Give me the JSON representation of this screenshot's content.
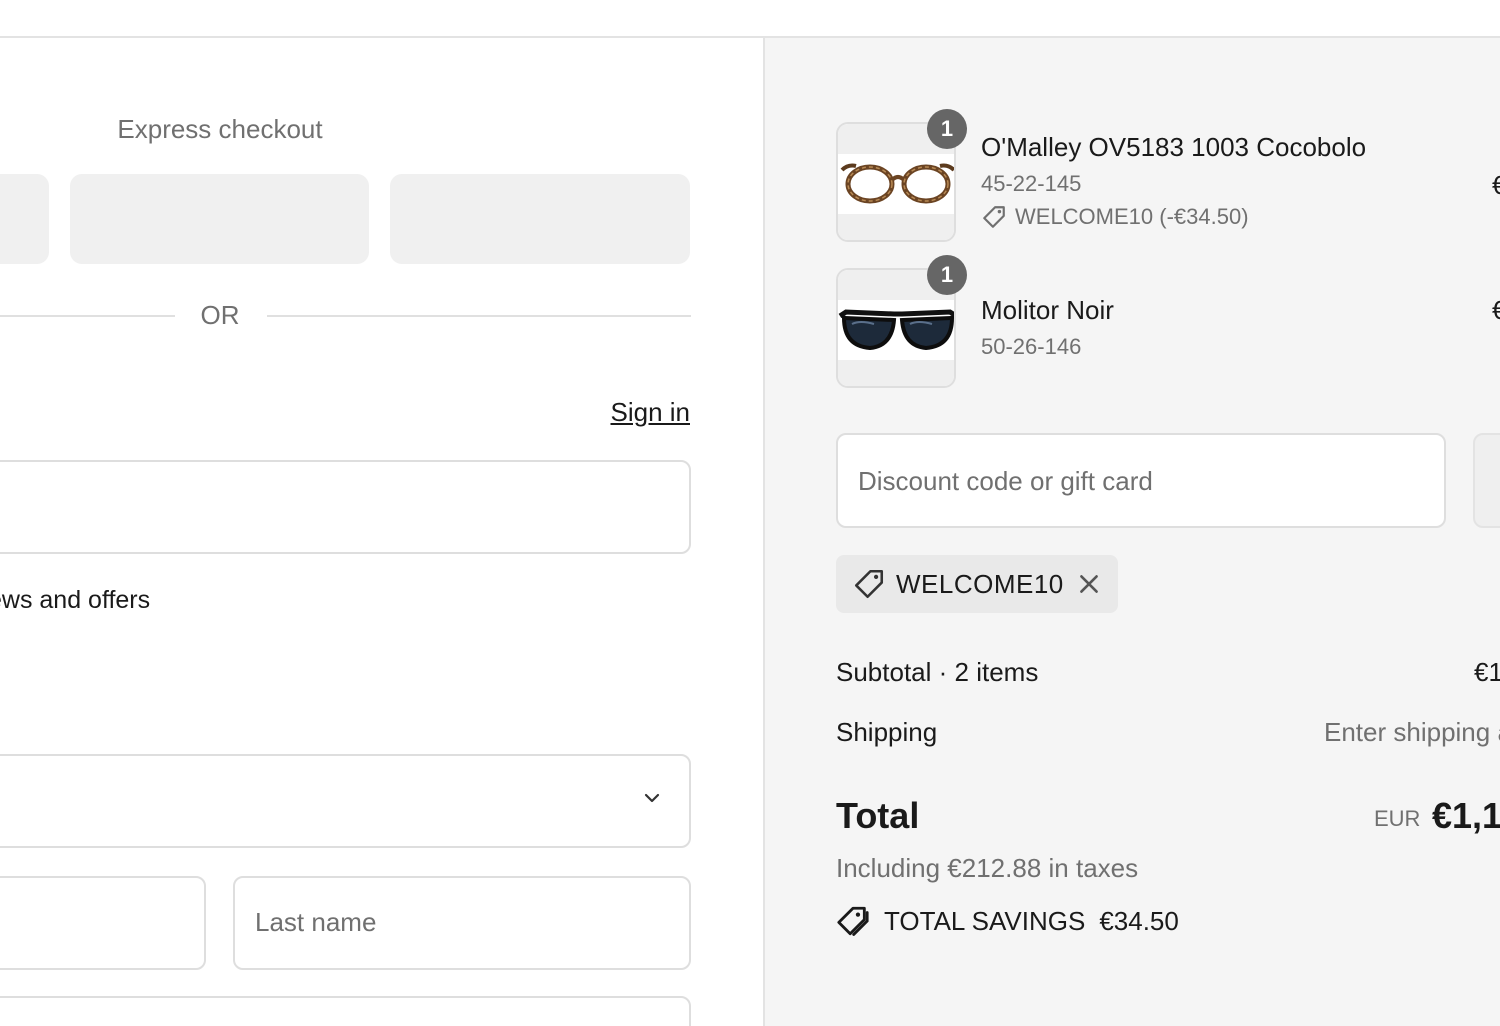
{
  "express_checkout": {
    "label": "Express checkout",
    "divider": "OR"
  },
  "contact": {
    "sign_in": "Sign in",
    "email_value": "",
    "news_label": "ews and offers"
  },
  "delivery": {
    "country_value": "",
    "first_name_value": "",
    "last_name_placeholder": "Last name"
  },
  "cart": {
    "items": [
      {
        "quantity": "1",
        "name": "O'Malley OV5183 1003 Cocobolo",
        "variant": "45-22-145",
        "discount": "WELCOME10 (-€34.50)",
        "price": "€"
      },
      {
        "quantity": "1",
        "name": "Molitor Noir",
        "variant": "50-26-146",
        "price": "€"
      }
    ]
  },
  "discount": {
    "placeholder": "Discount code or gift card",
    "applied_code": "WELCOME10"
  },
  "summary": {
    "subtotal_label": "Subtotal · 2 items",
    "subtotal_value": "€1",
    "shipping_label": "Shipping",
    "shipping_value": "Enter shipping a",
    "total_label": "Total",
    "currency": "EUR",
    "total_value": "€1,1",
    "taxes": "Including €212.88 in taxes",
    "savings_label": "TOTAL SAVINGS",
    "savings_value": "€34.50"
  },
  "colors": {
    "text": "#1a1a1a",
    "muted": "#707070",
    "summary_bg": "#f5f5f5",
    "border": "#dedede",
    "badge": "#666666"
  }
}
